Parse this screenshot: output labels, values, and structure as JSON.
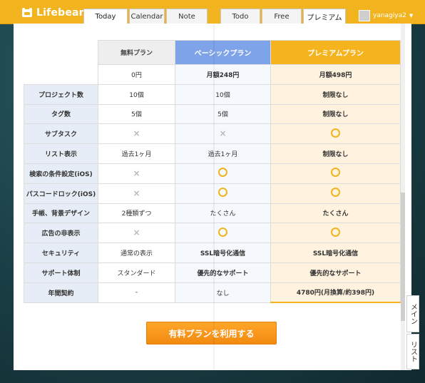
{
  "app": {
    "name": "Lifebear"
  },
  "tabs_left": [
    "Today",
    "Calendar",
    "Note"
  ],
  "tabs_right": [
    "Todo",
    "Free",
    "プレミアム"
  ],
  "user": {
    "name": "yanagiya2"
  },
  "side_tabs": {
    "main": "メイン",
    "list": "リスト"
  },
  "plans": {
    "free": "無料プラン",
    "basic": "ベーシックプラン",
    "premium": "プレミアムプラン"
  },
  "prices": {
    "free": "0円",
    "basic": "月額248円",
    "premium": "月額498円"
  },
  "rows": [
    {
      "label": "プロジェクト数",
      "free": "10個",
      "basic": "10個",
      "premium": "制限なし"
    },
    {
      "label": "タグ数",
      "free": "5個",
      "basic": "5個",
      "premium": "制限なし"
    },
    {
      "label": "サブタスク",
      "free": "×",
      "basic": "×",
      "premium": "○"
    },
    {
      "label": "リスト表示",
      "free": "過去1ヶ月",
      "basic": "過去1ヶ月",
      "premium": "制限なし"
    },
    {
      "label": "検索の条件設定(iOS)",
      "free": "×",
      "basic": "○",
      "premium": "○"
    },
    {
      "label": "パスコードロック(iOS)",
      "free": "×",
      "basic": "○",
      "premium": "○"
    },
    {
      "label": "手帳、背景デザイン",
      "free": "2種類ずつ",
      "basic": "たくさん",
      "premium": "たくさん"
    },
    {
      "label": "広告の非表示",
      "free": "×",
      "basic": "○",
      "premium": "○"
    },
    {
      "label": "セキュリティ",
      "free": "通常の表示",
      "basic": "SSL暗号化通信",
      "premium": "SSL暗号化通信"
    },
    {
      "label": "サポート体制",
      "free": "スタンダード",
      "basic": "優先的なサポート",
      "premium": "優先的なサポート"
    },
    {
      "label": "年間契約",
      "free": "-",
      "basic": "なし",
      "premium": "4780円(月換算/約398円)"
    }
  ],
  "cta": {
    "label": "有料プランを利用する"
  },
  "colors": {
    "accent": "#f2b41e",
    "basic_header": "#7fa3e8",
    "cta": "#f28a10"
  }
}
